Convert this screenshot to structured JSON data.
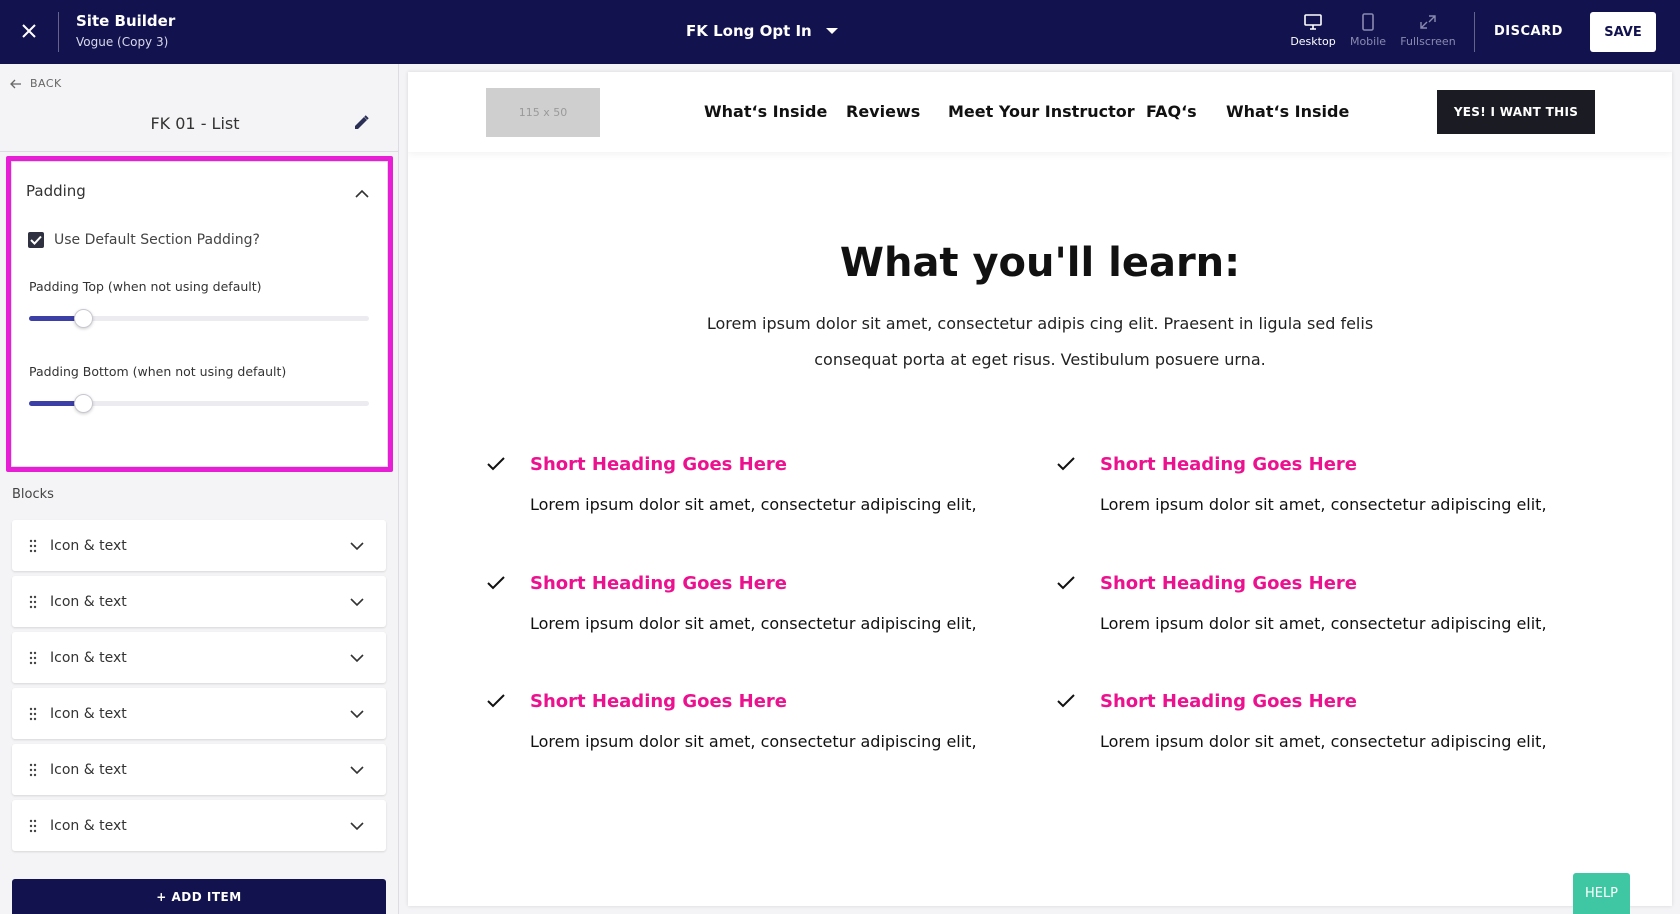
{
  "app": {
    "title": "Site Builder",
    "subtitle": "Vogue (Copy 3)"
  },
  "page_selector": {
    "current": "FK Long Opt In"
  },
  "view_modes": [
    {
      "label": "Desktop",
      "icon": "desktop-icon",
      "active": true
    },
    {
      "label": "Mobile",
      "icon": "mobile-icon",
      "active": false
    },
    {
      "label": "Fullscreen",
      "icon": "fullscreen-icon",
      "active": false
    }
  ],
  "actions": {
    "discard": "DISCARD",
    "save": "SAVE"
  },
  "sidebar": {
    "back": "BACK",
    "section_name": "FK 01 - List",
    "padding": {
      "title": "Padding",
      "use_default_label": "Use Default Section Padding?",
      "use_default_checked": true,
      "top_label": "Padding Top (when not using default)",
      "top_value_fraction": 0.16,
      "bottom_label": "Padding Bottom (when not using default)",
      "bottom_value_fraction": 0.16
    },
    "blocks_label": "Blocks",
    "blocks": [
      {
        "label": "Icon & text"
      },
      {
        "label": "Icon & text"
      },
      {
        "label": "Icon & text"
      },
      {
        "label": "Icon & text"
      },
      {
        "label": "Icon & text"
      },
      {
        "label": "Icon & text"
      }
    ],
    "add_item": "+ ADD ITEM"
  },
  "preview": {
    "logo_placeholder": "115 x 50",
    "nav": [
      "What‘s Inside",
      "Reviews",
      "Meet Your Instructor",
      "FAQ‘s",
      "What‘s Inside"
    ],
    "cta": "YES! I WANT THIS",
    "heading": "What you'll learn:",
    "intro": "Lorem ipsum dolor sit amet, consectetur adipis cing elit. Praesent in ligula sed felis consequat porta at eget risus. Vestibulum posuere urna.",
    "features": [
      {
        "heading": "Short Heading Goes Here",
        "body": "Lorem ipsum dolor sit amet, consectetur adipiscing elit,"
      },
      {
        "heading": "Short Heading Goes Here",
        "body": "Lorem ipsum dolor sit amet, consectetur adipiscing elit,"
      },
      {
        "heading": "Short Heading Goes Here",
        "body": "Lorem ipsum dolor sit amet, consectetur adipiscing elit,"
      },
      {
        "heading": "Short Heading Goes Here",
        "body": "Lorem ipsum dolor sit amet, consectetur adipiscing elit,"
      },
      {
        "heading": "Short Heading Goes Here",
        "body": "Lorem ipsum dolor sit amet, consectetur adipiscing elit,"
      },
      {
        "heading": "Short Heading Goes Here",
        "body": "Lorem ipsum dolor sit amet, consectetur adipiscing elit,"
      }
    ]
  },
  "help": "HELP",
  "colors": {
    "topbar": "#12124e",
    "highlight": "#e81ed6",
    "feature_heading": "#ec128f",
    "help": "#3ec7a2"
  }
}
